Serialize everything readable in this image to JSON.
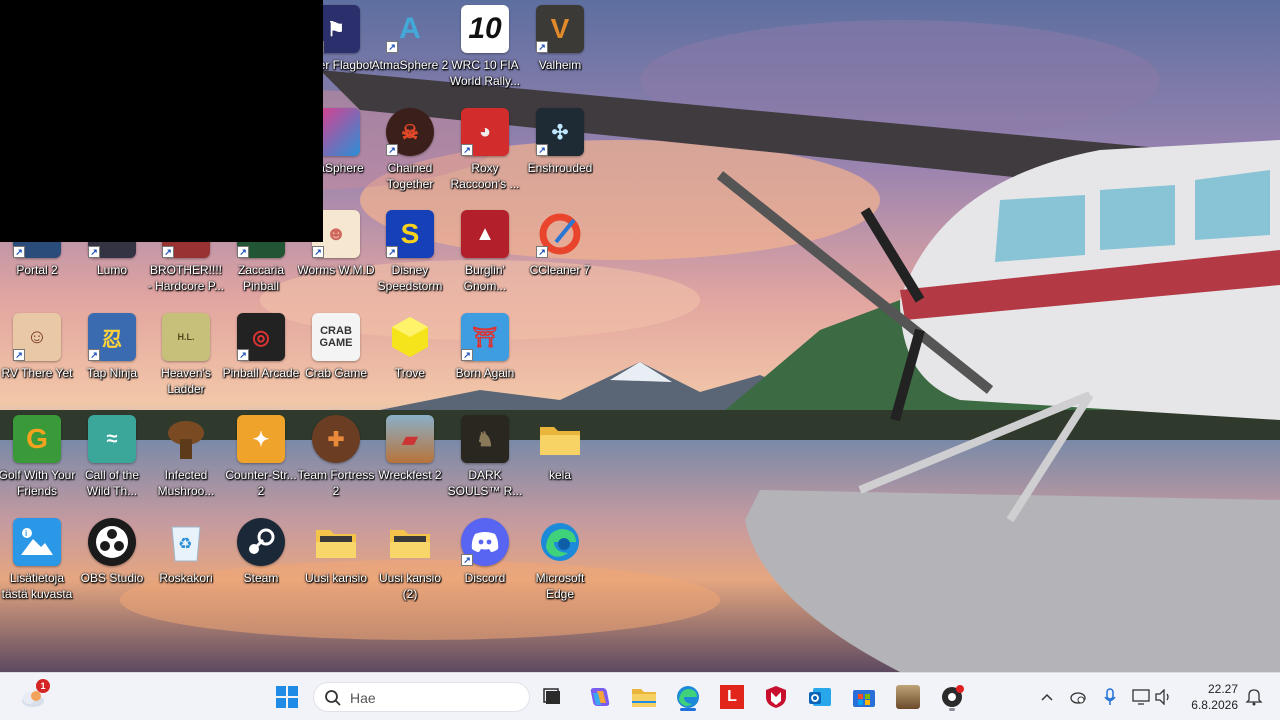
{
  "desktop": {
    "icons": [
      {
        "id": "super-flagbot",
        "label": "super Flagbot",
        "icon": "super-flagbot-icon"
      },
      {
        "id": "atmasphere-2",
        "label": "AtmaSphere 2",
        "icon": "atmasphere-2-icon"
      },
      {
        "id": "wrc-10",
        "label": "WRC 10 FIA World Rally...",
        "icon": "wrc10-icon"
      },
      {
        "id": "valheim",
        "label": "Valheim",
        "icon": "valheim-icon"
      },
      {
        "id": "atmasphere",
        "label": "maSphere",
        "icon": "atmasphere-icon"
      },
      {
        "id": "chained-together",
        "label": "Chained Together",
        "icon": "chained-together-icon"
      },
      {
        "id": "roxy-raccoon",
        "label": "Roxy Raccoon's ...",
        "icon": "roxy-raccoon-icon"
      },
      {
        "id": "enshrouded",
        "label": "Enshrouded",
        "icon": "enshrouded-icon"
      },
      {
        "id": "portal-2",
        "label": "Portal 2",
        "icon": "portal2-icon"
      },
      {
        "id": "lumo",
        "label": "Lumo",
        "icon": "lumo-icon"
      },
      {
        "id": "brother",
        "label": "BROTHER!!!! - Hardcore P...",
        "icon": "brother-icon"
      },
      {
        "id": "zaccaria-pinball",
        "label": "Zaccaria Pinball",
        "icon": "zaccaria-icon"
      },
      {
        "id": "worms-wmd",
        "label": "Worms W.M.D",
        "icon": "worms-icon"
      },
      {
        "id": "disney-speedstorm",
        "label": "Disney Speedstorm",
        "icon": "speedstorm-icon"
      },
      {
        "id": "burglin-gnomes",
        "label": "Burglin' Gnom...",
        "icon": "burglin-gnomes-icon"
      },
      {
        "id": "ccleaner-7",
        "label": "CCleaner 7",
        "icon": "ccleaner-icon"
      },
      {
        "id": "rv-there-yet",
        "label": "RV There Yet",
        "icon": "rv-there-yet-icon"
      },
      {
        "id": "tap-ninja",
        "label": "Tap Ninja",
        "icon": "tap-ninja-icon"
      },
      {
        "id": "heavens-ladder",
        "label": "Heaven's Ladder",
        "icon": "heavens-ladder-icon"
      },
      {
        "id": "pinball-arcade",
        "label": "Pinball Arcade",
        "icon": "pinball-arcade-icon"
      },
      {
        "id": "crab-game",
        "label": "Crab Game",
        "icon": "crab-game-icon"
      },
      {
        "id": "trove",
        "label": "Trove",
        "icon": "trove-icon"
      },
      {
        "id": "born-again",
        "label": "Born Again",
        "icon": "born-again-icon"
      },
      {
        "id": "golf-with-friends",
        "label": "Golf With Your Friends",
        "icon": "golf-icon"
      },
      {
        "id": "call-of-the-wild",
        "label": "Call of the Wild Th...",
        "icon": "call-of-the-wild-icon"
      },
      {
        "id": "infected-mushroom",
        "label": "Infected Mushroo...",
        "icon": "mushroom-icon"
      },
      {
        "id": "counter-strike-2",
        "label": "Counter-Str... 2",
        "icon": "counter-strike-icon"
      },
      {
        "id": "team-fortress-2",
        "label": "Team Fortress 2",
        "icon": "tf2-icon"
      },
      {
        "id": "wreckfest-2",
        "label": "Wreckfest 2",
        "icon": "wreckfest-icon"
      },
      {
        "id": "dark-souls",
        "label": "DARK SOULS™ R...",
        "icon": "dark-souls-icon"
      },
      {
        "id": "kela",
        "label": "kela",
        "icon": "folder-icon"
      },
      {
        "id": "lisatietoja",
        "label": "Lisätietoja tästä kuvasta",
        "icon": "info-image-icon"
      },
      {
        "id": "obs-studio",
        "label": "OBS Studio",
        "icon": "obs-icon"
      },
      {
        "id": "roskakori",
        "label": "Roskakori",
        "icon": "recycle-bin-icon"
      },
      {
        "id": "steam",
        "label": "Steam",
        "icon": "steam-icon"
      },
      {
        "id": "uusi-kansio",
        "label": "Uusi kansio",
        "icon": "folder-icon"
      },
      {
        "id": "uusi-kansio-2",
        "label": "Uusi kansio (2)",
        "icon": "folder-icon"
      },
      {
        "id": "discord",
        "label": "Discord",
        "icon": "discord-icon"
      },
      {
        "id": "microsoft-edge",
        "label": "Microsoft Edge",
        "icon": "edge-icon"
      }
    ]
  },
  "taskbar": {
    "weather_badge": "1",
    "search_placeholder": "Hae",
    "pinned": [
      "start-icon",
      "task-view-icon",
      "copilot-icon",
      "file-explorer-icon",
      "edge-icon",
      "lenovo-icon",
      "mcafee-icon",
      "outlook-icon",
      "microsoft-store-icon",
      "game-icon",
      "chrome-like-icon"
    ],
    "tray": [
      "chevron-up-icon",
      "network-cloud-icon",
      "microphone-icon",
      "display-icon",
      "volume-icon",
      "notification-icon"
    ],
    "time": "22.27",
    "date": "6.8.2026"
  },
  "colors": {
    "taskbar_bg": "#f1f3f8",
    "accent": "#1e6fd9"
  }
}
